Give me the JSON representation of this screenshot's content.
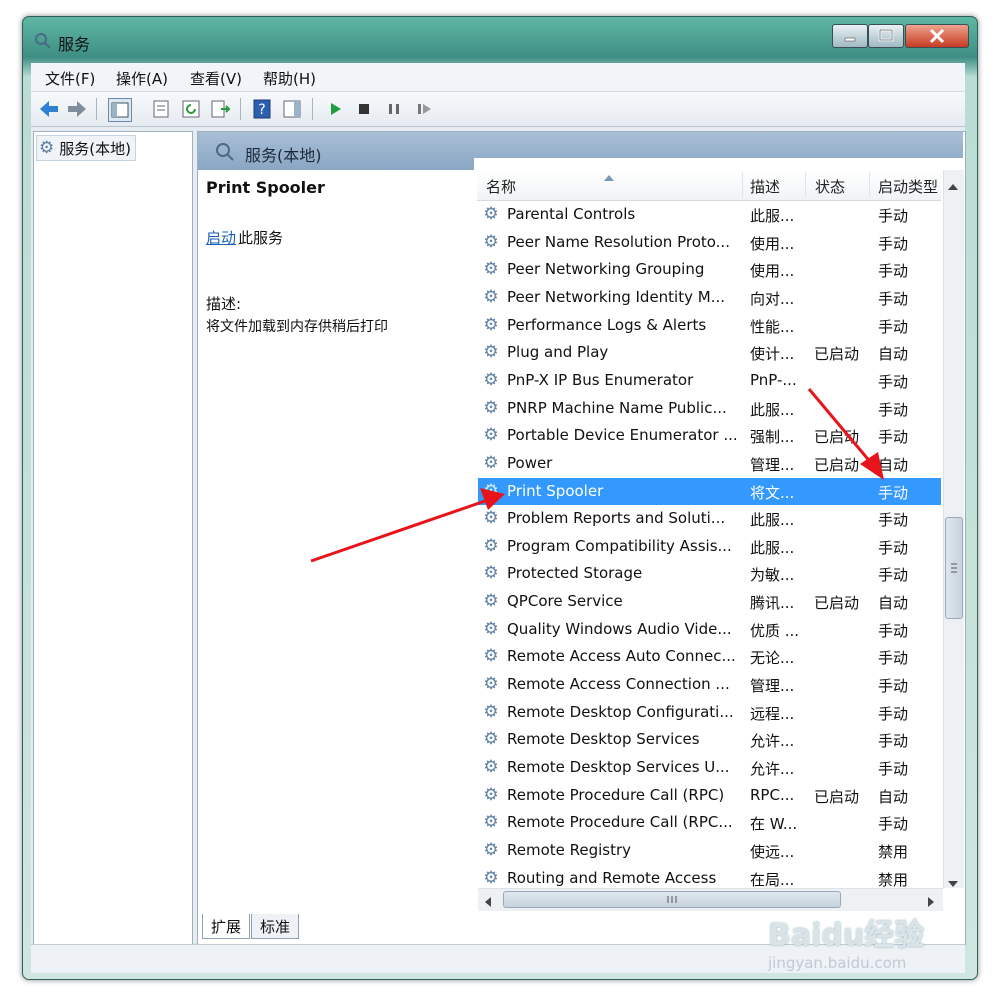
{
  "window": {
    "title": "服务",
    "min_icon": "minimize-icon",
    "max_icon": "maximize-icon",
    "close_icon": "close-icon"
  },
  "menu": [
    "文件(F)",
    "操作(A)",
    "查看(V)",
    "帮助(H)"
  ],
  "tree": {
    "item_label": "服务(本地)"
  },
  "pane": {
    "title": "服务(本地)",
    "service_name": "Print Spooler",
    "start_link": "启动",
    "start_rest": "此服务",
    "desc_label": "描述:",
    "desc_text": "将文件加载到内存供稍后打印"
  },
  "columns": [
    "名称",
    "描述",
    "状态",
    "启动类型"
  ],
  "services": [
    {
      "name": "Parental Controls",
      "desc": "此服...",
      "status": "",
      "start": "手动"
    },
    {
      "name": "Peer Name Resolution Proto...",
      "desc": "使用...",
      "status": "",
      "start": "手动"
    },
    {
      "name": "Peer Networking Grouping",
      "desc": "使用...",
      "status": "",
      "start": "手动"
    },
    {
      "name": "Peer Networking Identity M...",
      "desc": "向对...",
      "status": "",
      "start": "手动"
    },
    {
      "name": "Performance Logs & Alerts",
      "desc": "性能...",
      "status": "",
      "start": "手动"
    },
    {
      "name": "Plug and Play",
      "desc": "使计...",
      "status": "已启动",
      "start": "自动"
    },
    {
      "name": "PnP-X IP Bus Enumerator",
      "desc": "PnP-...",
      "status": "",
      "start": "手动"
    },
    {
      "name": "PNRP Machine Name Public...",
      "desc": "此服...",
      "status": "",
      "start": "手动"
    },
    {
      "name": "Portable Device Enumerator ...",
      "desc": "强制...",
      "status": "已启动",
      "start": "手动"
    },
    {
      "name": "Power",
      "desc": "管理...",
      "status": "已启动",
      "start": "自动"
    },
    {
      "name": "Print Spooler",
      "desc": "将文...",
      "status": "",
      "start": "手动",
      "selected": true
    },
    {
      "name": "Problem Reports and Soluti...",
      "desc": "此服...",
      "status": "",
      "start": "手动"
    },
    {
      "name": "Program Compatibility Assis...",
      "desc": "此服...",
      "status": "",
      "start": "手动"
    },
    {
      "name": "Protected Storage",
      "desc": "为敏...",
      "status": "",
      "start": "手动"
    },
    {
      "name": "QPCore Service",
      "desc": "腾讯...",
      "status": "已启动",
      "start": "自动"
    },
    {
      "name": "Quality Windows Audio Vide...",
      "desc": "优质 ...",
      "status": "",
      "start": "手动"
    },
    {
      "name": "Remote Access Auto Connec...",
      "desc": "无论...",
      "status": "",
      "start": "手动"
    },
    {
      "name": "Remote Access Connection ...",
      "desc": "管理...",
      "status": "",
      "start": "手动"
    },
    {
      "name": "Remote Desktop Configurati...",
      "desc": "远程...",
      "status": "",
      "start": "手动"
    },
    {
      "name": "Remote Desktop Services",
      "desc": "允许...",
      "status": "",
      "start": "手动"
    },
    {
      "name": "Remote Desktop Services U...",
      "desc": "允许...",
      "status": "",
      "start": "手动"
    },
    {
      "name": "Remote Procedure Call (RPC)",
      "desc": "RPC...",
      "status": "已启动",
      "start": "自动"
    },
    {
      "name": "Remote Procedure Call (RPC...",
      "desc": "在 W...",
      "status": "",
      "start": "手动"
    },
    {
      "name": "Remote Registry",
      "desc": "使远...",
      "status": "",
      "start": "禁用"
    },
    {
      "name": "Routing and Remote Access",
      "desc": "在局...",
      "status": "",
      "start": "禁用"
    }
  ],
  "tabs": [
    "扩展",
    "标准"
  ],
  "watermark": {
    "brand": "Baidu经验",
    "url": "jingyan.baidu.com"
  },
  "colors": {
    "selection": "#3399ff",
    "arrow": "#e8141c",
    "link": "#1a5fb4"
  }
}
